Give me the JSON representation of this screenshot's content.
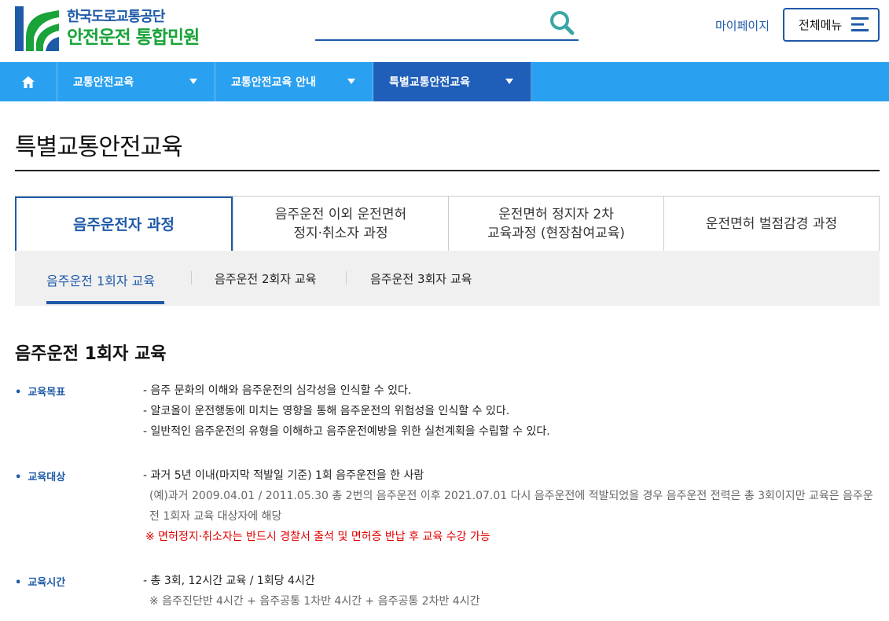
{
  "header": {
    "logo_line1": "한국도로교통공단",
    "logo_line2": "안전운전 통합민원",
    "search_placeholder": "",
    "mypage_label": "마이페이지",
    "allmenu_label": "전체메뉴"
  },
  "nav": {
    "home_icon": "home-icon",
    "items": [
      {
        "label": "교통안전교육"
      },
      {
        "label": "교통안전교육 안내"
      },
      {
        "label": "특별교통안전교육"
      }
    ],
    "active_index": 2
  },
  "page": {
    "title": "특별교통안전교육"
  },
  "tabs": [
    {
      "label": "음주운전자 과정"
    },
    {
      "label": "음주운전 이외 운전면허\n정지·취소자 과정"
    },
    {
      "label": "운전면허 정지자 2차\n교육과정 (현장참여교육)"
    },
    {
      "label": "운전면허 벌점감경 과정"
    }
  ],
  "subtabs": [
    {
      "label": "음주운전 1회자 교육"
    },
    {
      "label": "음주운전 2회자 교육"
    },
    {
      "label": "음주운전 3회자 교육"
    }
  ],
  "section": {
    "title": "음주운전 1회자 교육",
    "goal": {
      "label": "교육목표",
      "lines": [
        "- 음주 문화의 이해와 음주운전의 심각성을 인식할 수 있다.",
        "- 알코올이 운전행동에 미치는 영향을 통해 음주운전의 위험성을 인식할 수 있다.",
        "- 일반적인 음주운전의 유형을 이해하고 음주운전예방을 위한 실천계획을 수립할 수 있다."
      ]
    },
    "target": {
      "label": "교육대상",
      "line": "- 과거 5년 이내(마지막 적발일 기준) 1회 음주운전을 한 사람",
      "note": "(예)과거 2009.04.01 / 2011.05.30 총 2번의 음주운전 이후 2021.07.01 다시 음주운전에 적발되었을 경우 음주운전 전력은 총 3회이지만 교육은 음주운전 1회자 교육 대상자에 해당",
      "warning": "※ 면허정지·취소자는 반드시 경찰서 출석 및 면허증 반납 후 교육 수강 가능"
    },
    "time": {
      "label": "교육시간",
      "line": "- 총 3회, 12시간 교육 / 1회당 4시간",
      "note": "※ 음주진단반 4시간 + 음주공통 1차반 4시간 + 음주공통 2차반 4시간"
    }
  },
  "colors": {
    "brand_blue": "#1e5aa8",
    "brand_green": "#19a339",
    "nav_bg": "#2aa0f0",
    "nav_active": "#1f5fb9",
    "warning": "#e00000"
  }
}
